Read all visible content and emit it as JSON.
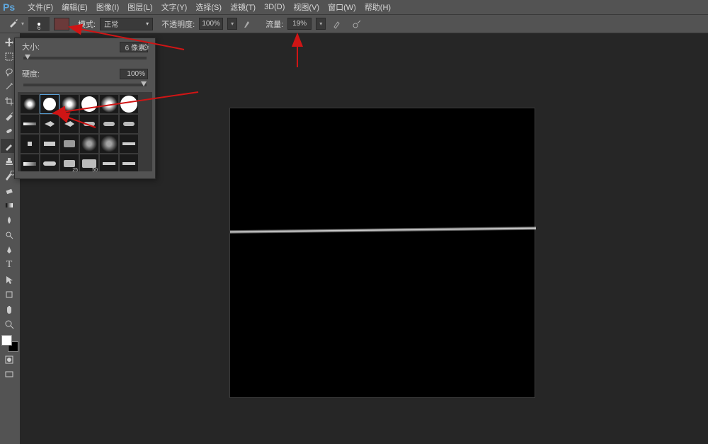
{
  "app": {
    "logo": "Ps"
  },
  "menu": {
    "items": [
      "文件(F)",
      "编辑(E)",
      "图像(I)",
      "图层(L)",
      "文字(Y)",
      "选择(S)",
      "滤镜(T)",
      "3D(D)",
      "视图(V)",
      "窗口(W)",
      "帮助(H)"
    ]
  },
  "options": {
    "brush_size_display": "6",
    "mode_label": "模式:",
    "mode_value": "正常",
    "opacity_label": "不透明度:",
    "opacity_value": "100%",
    "flow_label": "流量:",
    "flow_value": "19%"
  },
  "brush_panel": {
    "size_label": "大小:",
    "size_value": "6 像素",
    "hardness_label": "硬度:",
    "hardness_value": "100%",
    "preset_labels": {
      "p25": "25",
      "p50": "50"
    }
  },
  "colors": {
    "accent_red": "#d01515"
  }
}
